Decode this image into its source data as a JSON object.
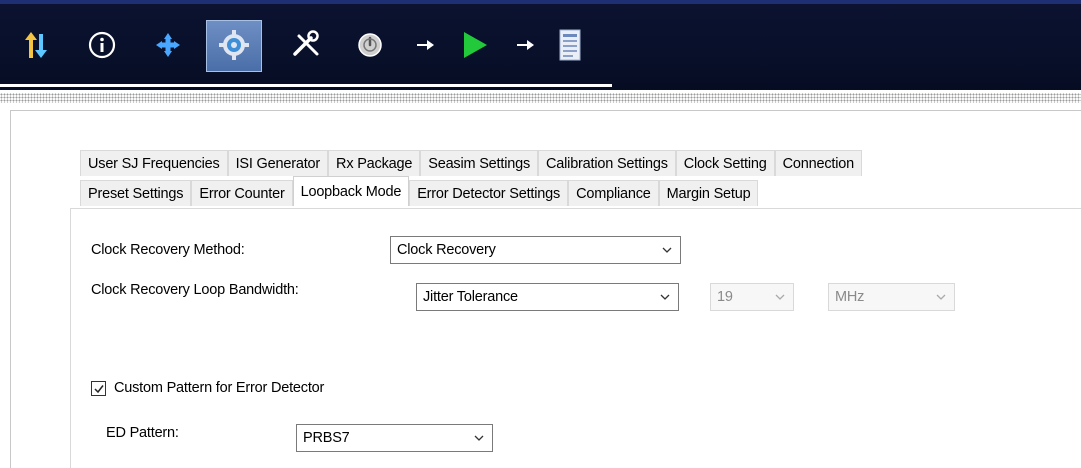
{
  "toolbar": {
    "icons": [
      "transfer-arrows-icon",
      "info-icon",
      "move-icon",
      "gear-icon",
      "tools-icon",
      "power-icon",
      "arrow-right-icon",
      "play-icon",
      "arrow-right-icon",
      "report-icon"
    ],
    "selected": "gear-icon",
    "accent": "#4a6ea8"
  },
  "tabs": {
    "row1": [
      "User SJ Frequencies",
      "ISI Generator",
      "Rx Package",
      "Seasim Settings",
      "Calibration Settings",
      "Clock Setting",
      "Connection"
    ],
    "row2": [
      "Preset Settings",
      "Error Counter",
      "Loopback Mode",
      "Error Detector Settings",
      "Compliance",
      "Margin Setup"
    ],
    "active": "Loopback Mode"
  },
  "form": {
    "clock_recovery_method_label": "Clock Recovery Method:",
    "clock_recovery_method_value": "Clock Recovery",
    "loop_bandwidth_label": "Clock Recovery Loop Bandwidth:",
    "loop_bandwidth_value": "Jitter Tolerance",
    "bandwidth_number": "19",
    "bandwidth_unit": "MHz",
    "custom_pattern_label": "Custom Pattern for Error Detector",
    "custom_pattern_checked": true,
    "ed_pattern_label": "ED Pattern:",
    "ed_pattern_value": "PRBS7"
  }
}
